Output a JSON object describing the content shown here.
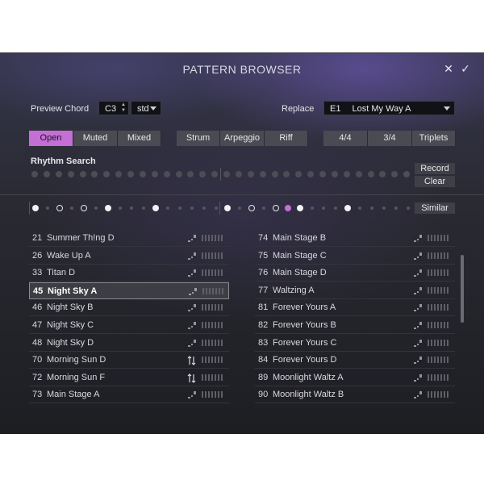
{
  "window": {
    "title": "PATTERN BROWSER"
  },
  "header": {
    "close_icon": "✕",
    "confirm_icon": "✓"
  },
  "preview": {
    "label": "Preview Chord",
    "note": "C3",
    "type": "std"
  },
  "replace": {
    "label": "Replace",
    "slot": "E1",
    "pattern": "Lost My Way A"
  },
  "style_tabs": [
    {
      "label": "Open",
      "active": true
    },
    {
      "label": "Muted",
      "active": false
    },
    {
      "label": "Mixed",
      "active": false
    }
  ],
  "type_tabs": [
    {
      "label": "Strum",
      "active": false
    },
    {
      "label": "Arpeggio",
      "active": false
    },
    {
      "label": "Riff",
      "active": false
    }
  ],
  "meter_tabs": [
    {
      "label": "4/4",
      "active": false
    },
    {
      "label": "3/4",
      "active": false
    },
    {
      "label": "Triplets",
      "active": false
    }
  ],
  "rhythm_search": {
    "label": "Rhythm Search",
    "record_label": "Record",
    "clear_label": "Clear"
  },
  "similar": {
    "label": "Similar"
  },
  "pattern_preview": {
    "steps": [
      "big-white",
      "small",
      "ring",
      "small",
      "ring",
      "small",
      "big-white",
      "small",
      "small",
      "small",
      "big-white",
      "small",
      "small",
      "small",
      "small",
      "small",
      "big-white",
      "small",
      "ring",
      "small",
      "ring",
      "pink",
      "big-white",
      "small",
      "small",
      "small",
      "big-white",
      "small",
      "small",
      "small",
      "small",
      "small"
    ]
  },
  "colors": {
    "accent": "#c56fd6",
    "panel": "#26272c",
    "button": "#4a4b52"
  },
  "list_left": [
    {
      "num": "21",
      "name": "Summer Th!ng D",
      "icon": "strum-icon",
      "selected": false
    },
    {
      "num": "26",
      "name": "Wake Up A",
      "icon": "strum-icon",
      "selected": false
    },
    {
      "num": "33",
      "name": "Titan D",
      "icon": "strum-icon",
      "selected": false
    },
    {
      "num": "45",
      "name": "Night Sky A",
      "icon": "strum-icon",
      "selected": true
    },
    {
      "num": "46",
      "name": "Night Sky B",
      "icon": "strum-icon",
      "selected": false
    },
    {
      "num": "47",
      "name": "Night Sky C",
      "icon": "strum-icon",
      "selected": false
    },
    {
      "num": "48",
      "name": "Night Sky D",
      "icon": "strum-icon",
      "selected": false
    },
    {
      "num": "70",
      "name": "Morning Sun D",
      "icon": "updown-icon",
      "selected": false
    },
    {
      "num": "72",
      "name": "Morning Sun F",
      "icon": "updown-icon",
      "selected": false
    },
    {
      "num": "73",
      "name": "Main Stage A",
      "icon": "strum-icon",
      "selected": false
    }
  ],
  "list_right": [
    {
      "num": "74",
      "name": "Main Stage B",
      "icon": "strum-icon",
      "selected": false
    },
    {
      "num": "75",
      "name": "Main Stage C",
      "icon": "strum-icon",
      "selected": false
    },
    {
      "num": "76",
      "name": "Main Stage D",
      "icon": "strum-icon",
      "selected": false
    },
    {
      "num": "77",
      "name": "Waltzing A",
      "icon": "strum-icon",
      "selected": false
    },
    {
      "num": "81",
      "name": "Forever Yours A",
      "icon": "strum-icon",
      "selected": false
    },
    {
      "num": "82",
      "name": "Forever Yours B",
      "icon": "strum-icon",
      "selected": false
    },
    {
      "num": "83",
      "name": "Forever Yours C",
      "icon": "strum-icon",
      "selected": false
    },
    {
      "num": "84",
      "name": "Forever Yours D",
      "icon": "strum-icon",
      "selected": false
    },
    {
      "num": "89",
      "name": "Moonlight Waltz A",
      "icon": "strum-icon",
      "selected": false
    },
    {
      "num": "90",
      "name": "Moonlight Waltz B",
      "icon": "strum-icon",
      "selected": false
    }
  ]
}
